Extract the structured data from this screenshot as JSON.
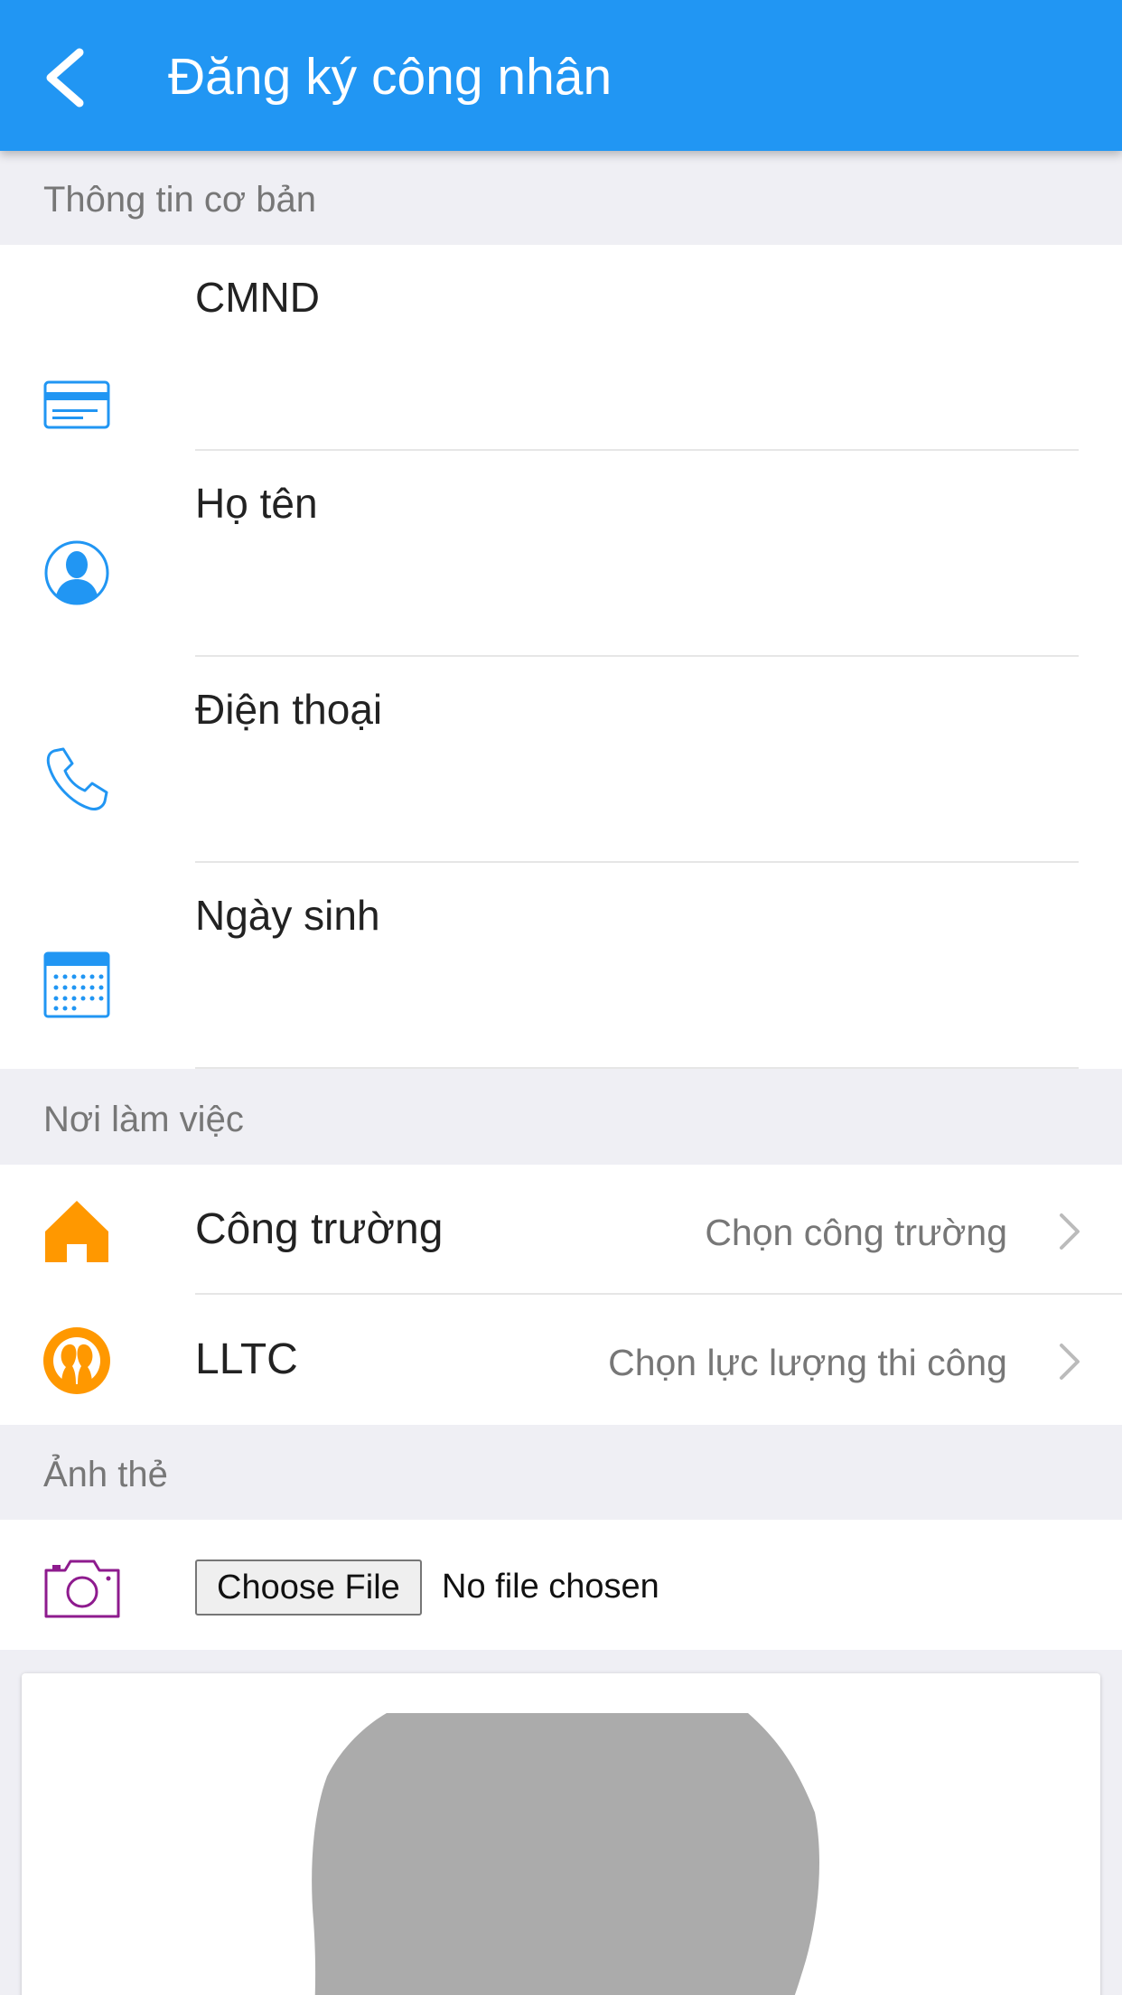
{
  "header": {
    "title": "Đăng ký công nhân"
  },
  "sections": {
    "basic_info": "Thông tin cơ bản",
    "workplace": "Nơi làm việc",
    "id_photo": "Ảnh thẻ"
  },
  "fields": {
    "cmnd": {
      "label": "CMND",
      "value": "",
      "icon": "id-card-icon"
    },
    "name": {
      "label": "Họ tên",
      "value": "",
      "icon": "person-icon"
    },
    "phone": {
      "label": "Điện thoại",
      "value": "",
      "icon": "phone-icon"
    },
    "birthday": {
      "label": "Ngày sinh",
      "value": "",
      "icon": "calendar-icon"
    }
  },
  "workplace": {
    "site": {
      "label": "Công trường",
      "value": "Chọn công trường",
      "icon": "home-icon"
    },
    "force": {
      "label": "LLTC",
      "value": "Chọn lực lượng thi công",
      "icon": "group-icon"
    }
  },
  "file": {
    "button_label": "Choose File",
    "status": "No file chosen"
  },
  "colors": {
    "primary": "#2196f3",
    "orange": "#ff9800",
    "purple": "#8e1b8e",
    "background": "#efeff4"
  }
}
